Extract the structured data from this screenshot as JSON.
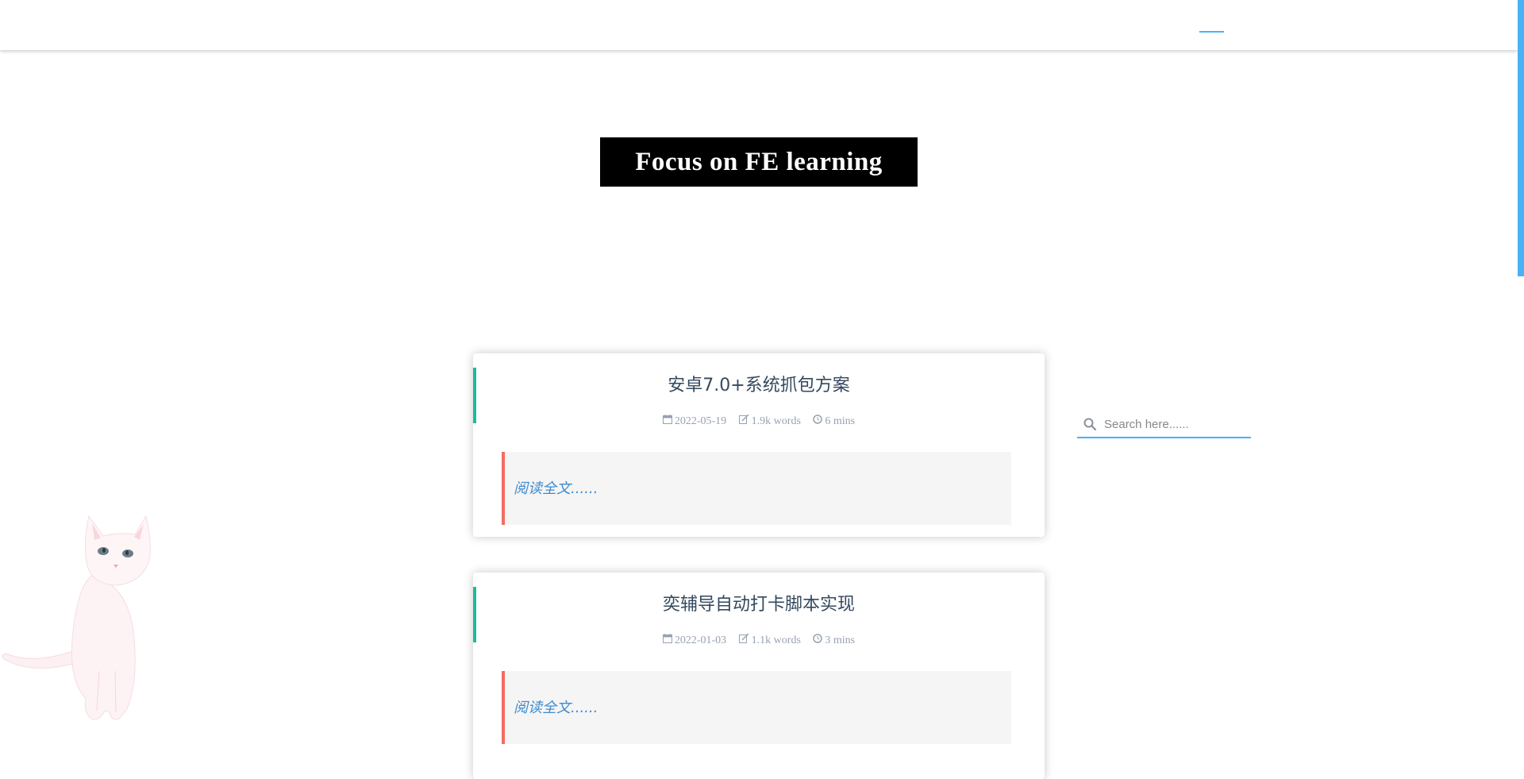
{
  "hero": {
    "title": "Focus on FE learning"
  },
  "posts": [
    {
      "title": "安卓7.0+系统抓包方案",
      "date": "2022-05-19",
      "words": "1.9k words",
      "time": "6 mins",
      "excerpt": "阅读全文......"
    },
    {
      "title": "奕辅导自动打卡脚本实现",
      "date": "2022-01-03",
      "words": "1.1k words",
      "time": "3 mins",
      "excerpt": "阅读全文......"
    }
  ],
  "search": {
    "placeholder": "Search here......"
  },
  "colors": {
    "accent": "#49b1f5",
    "card_accent": "#1abc9c",
    "quote_border": "#f56c62",
    "link": "#3f8ccf"
  },
  "icons": {
    "date": "calendar-icon",
    "words": "edit-icon",
    "time": "clock-icon",
    "search": "search-icon"
  }
}
